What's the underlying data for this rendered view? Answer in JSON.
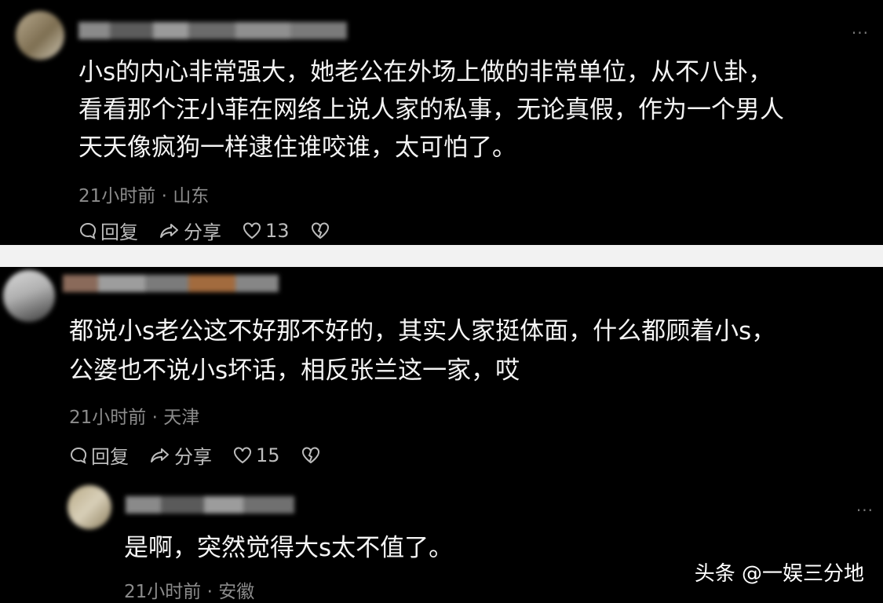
{
  "comments": [
    {
      "text_lines": [
        "小s的内心非常强大，她老公在外场上做的非常单位，从不八卦，",
        "看看那个汪小菲在网络上说人家的私事，无论真假，作为一个男人",
        "天天像疯狗一样逮住谁咬谁，太可怕了。"
      ],
      "meta": "21小时前 · 山东",
      "reply_label": "回复",
      "share_label": "分享",
      "like_count": "13"
    },
    {
      "text_lines": [
        "都说小s老公这不好那不好的，其实人家挺体面，什么都顾着小s，",
        "公婆也不说小s坏话，相反张兰这一家，哎"
      ],
      "meta": "21小时前 · 天津",
      "reply_label": "回复",
      "share_label": "分享",
      "like_count": "15"
    },
    {
      "text_lines": [
        "是啊，突然觉得大s太不值了。"
      ],
      "meta": "21小时前 · 安徽"
    }
  ],
  "more_glyph": "···",
  "watermark": "头条 @一娱三分地",
  "icons": [
    "comment-icon",
    "share-icon",
    "heart-icon",
    "broken-heart-icon",
    "more-icon"
  ]
}
